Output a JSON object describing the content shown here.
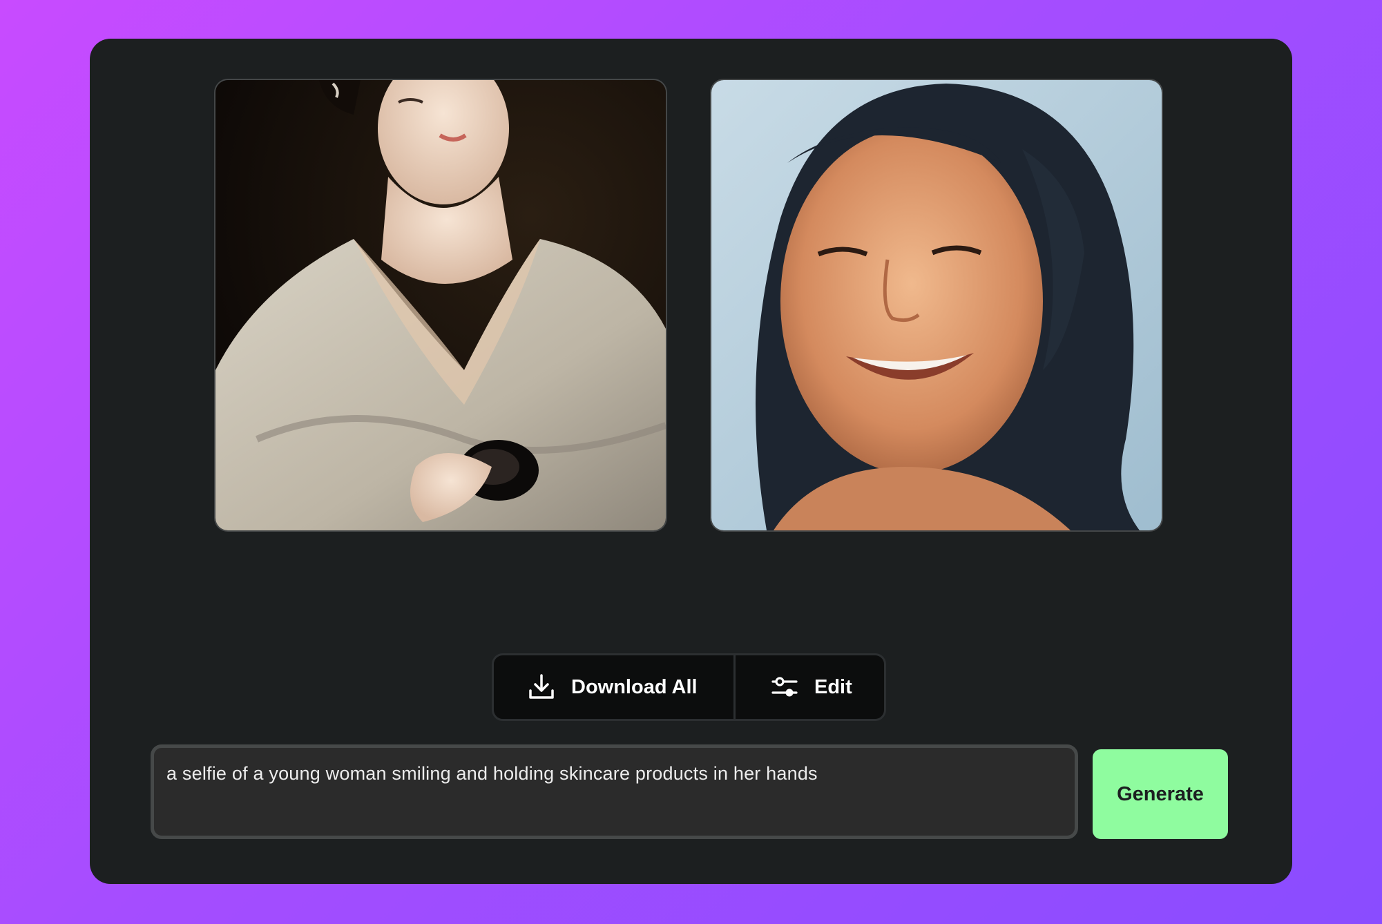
{
  "images": [
    {
      "name": "generated-image-1"
    },
    {
      "name": "generated-image-2"
    }
  ],
  "actions": {
    "download_all_label": "Download All",
    "download_icon": "download-icon",
    "edit_label": "Edit",
    "edit_icon": "sliders-icon"
  },
  "prompt": {
    "value": "a selfie of a young woman smiling and holding skincare products in her hands"
  },
  "generate_label": "Generate",
  "colors": {
    "background_gradient_start": "#c84bff",
    "background_gradient_end": "#8a4cff",
    "panel": "#1c1f20",
    "generate_button": "#8ffc9f",
    "prompt_field": "#2b2b2b"
  }
}
